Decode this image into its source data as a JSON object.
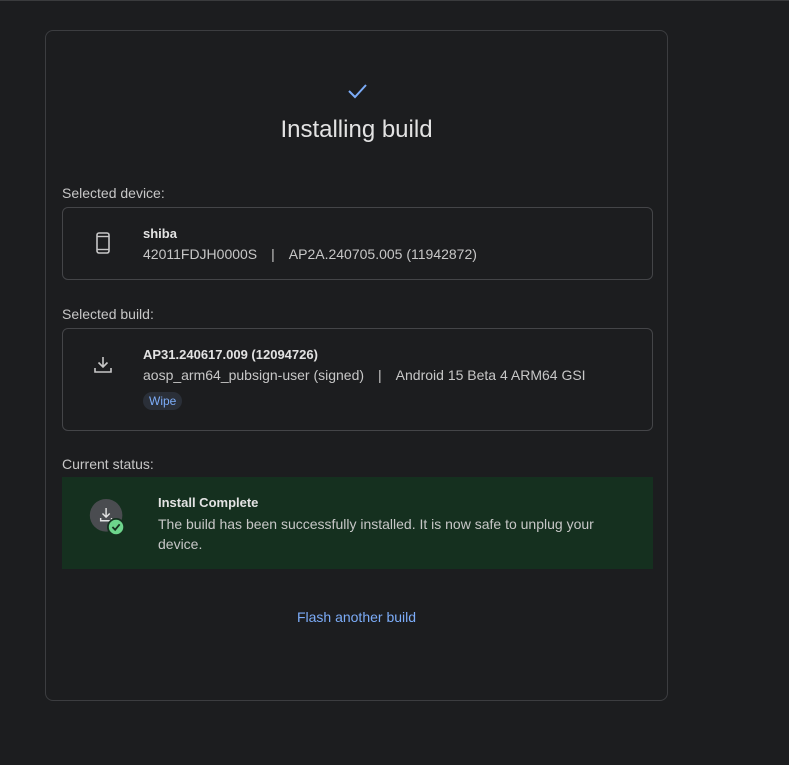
{
  "header": {
    "title": "Installing build",
    "status_icon": "check-icon",
    "accent_color": "#7cacf8"
  },
  "device": {
    "section_label": "Selected device:",
    "icon": "phone-icon",
    "name": "shiba",
    "serial": "42011FDJH0000S",
    "separator": "|",
    "build": "AP2A.240705.005 (11942872)"
  },
  "build": {
    "section_label": "Selected build:",
    "icon": "download-icon",
    "id": "AP31.240617.009 (12094726)",
    "target": "aosp_arm64_pubsign-user (signed)",
    "separator": "|",
    "description": "Android 15 Beta 4 ARM64 GSI",
    "chip": "Wipe"
  },
  "status": {
    "section_label": "Current status:",
    "icon": "install-complete-icon",
    "title": "Install Complete",
    "message": "The build has been successfully installed. It is now safe to unplug your device.",
    "background_color": "#15301f",
    "success_color": "#6dd58c"
  },
  "actions": {
    "flash_another": "Flash another build"
  }
}
